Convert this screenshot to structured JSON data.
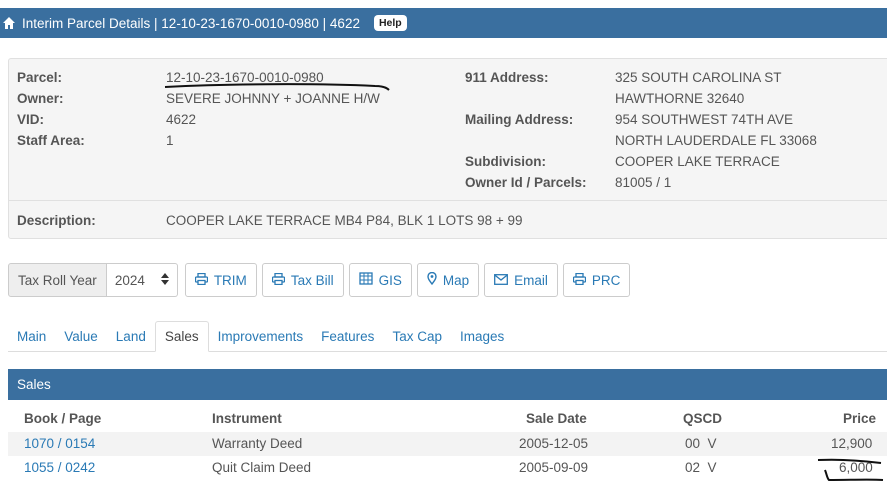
{
  "header": {
    "title": "Interim Parcel Details | 12-10-23-1670-0010-0980 | 4622",
    "help_label": "Help"
  },
  "details": {
    "parcel_label": "Parcel:",
    "parcel_value": "12-10-23-1670-0010-0980",
    "owner_label": "Owner:",
    "owner_value": "SEVERE JOHNNY + JOANNE H/W",
    "vid_label": "VID:",
    "vid_value": "4622",
    "staff_area_label": "Staff Area:",
    "staff_area_value": "1",
    "address_911_label": "911 Address:",
    "address_911_line1": "325 SOUTH CAROLINA ST",
    "address_911_line2": "HAWTHORNE 32640",
    "mailing_label": "Mailing Address:",
    "mailing_line1": "954 SOUTHWEST 74TH AVE",
    "mailing_line2": "NORTH LAUDERDALE FL 33068",
    "subdivision_label": "Subdivision:",
    "subdivision_value": "COOPER LAKE TERRACE",
    "owner_id_label": "Owner Id / Parcels:",
    "owner_id_value": "81005 / 1",
    "description_label": "Description:",
    "description_value": "COOPER LAKE TERRACE MB4 P84, BLK 1 LOTS 98 + 99"
  },
  "toolbar": {
    "tax_roll_label": "Tax Roll Year",
    "tax_roll_value": "2024",
    "trim_label": "TRIM",
    "tax_bill_label": "Tax Bill",
    "gis_label": "GIS",
    "map_label": "Map",
    "email_label": "Email",
    "prc_label": "PRC"
  },
  "tabs": {
    "main": "Main",
    "value": "Value",
    "land": "Land",
    "sales": "Sales",
    "improvements": "Improvements",
    "features": "Features",
    "tax_cap": "Tax Cap",
    "images": "Images"
  },
  "sales": {
    "title": "Sales",
    "columns": {
      "book_page": "Book / Page",
      "instrument": "Instrument",
      "sale_date": "Sale Date",
      "qscd": "QSCD",
      "price": "Price"
    },
    "rows": [
      {
        "book_page": "1070 / 0154",
        "instrument": "Warranty Deed",
        "sale_date": "2005-12-05",
        "qscd": "00  V",
        "price": "12,900"
      },
      {
        "book_page": "1055 / 0242",
        "instrument": "Quit Claim Deed",
        "sale_date": "2005-09-09",
        "qscd": "02  V",
        "price": "6,000"
      }
    ]
  },
  "colors": {
    "header_bg": "#3a6f9f",
    "link": "#2a7ab5",
    "panel_bg": "#f5f5f5"
  },
  "icons": [
    "home-icon",
    "print-icon",
    "gis-icon",
    "map-marker-icon",
    "envelope-icon",
    "sort-icon"
  ]
}
